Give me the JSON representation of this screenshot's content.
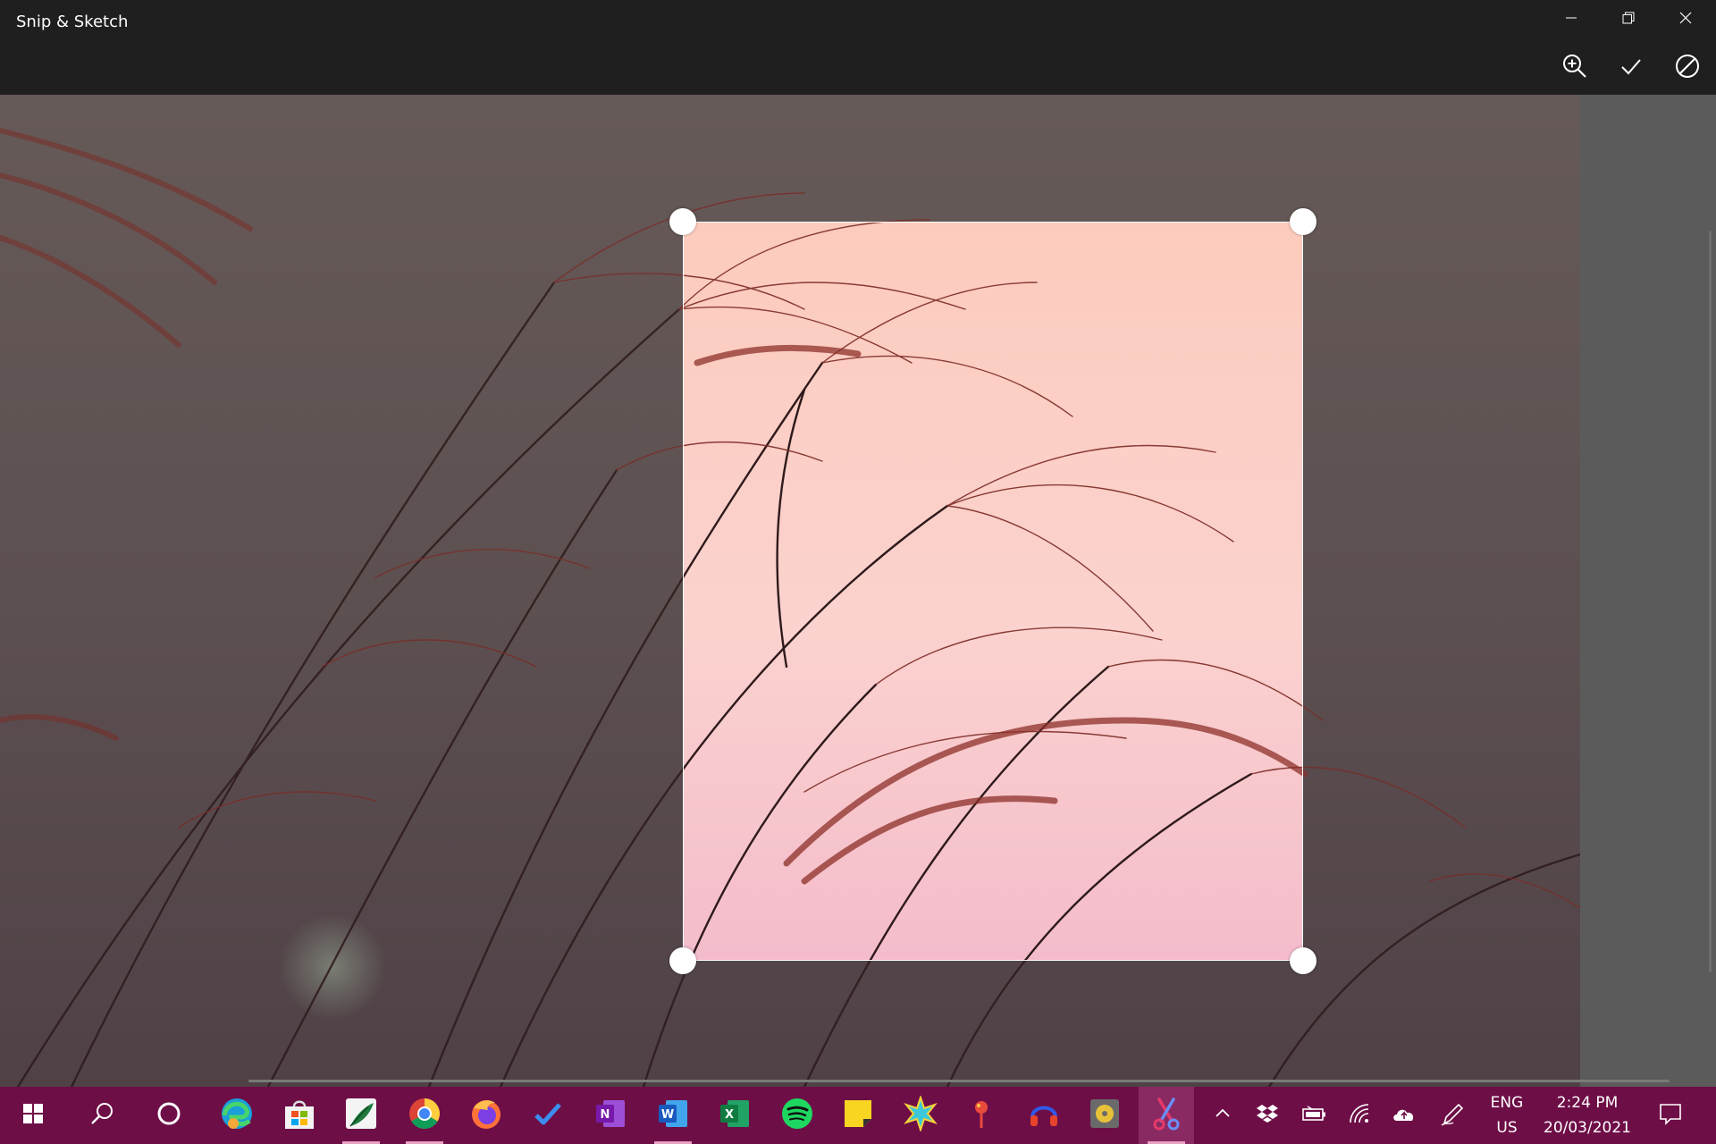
{
  "window": {
    "title": "Snip & Sketch",
    "controls": {
      "minimize": "minimize-icon",
      "restore": "restore-icon",
      "close": "close-icon"
    }
  },
  "toolbar": {
    "zoom": "zoom-in-icon",
    "apply": "checkmark-icon",
    "cancel": "cancel-icon"
  },
  "canvas": {
    "image": "photo of pampas grass against a pink dusk sky",
    "crop_state": "crop selection active"
  },
  "taskbar": {
    "apps": [
      {
        "name": "start",
        "icon": "windows-logo-icon"
      },
      {
        "name": "search",
        "icon": "search-icon"
      },
      {
        "name": "cortana",
        "icon": "cortana-icon"
      },
      {
        "name": "edge",
        "icon": "edge-icon"
      },
      {
        "name": "store",
        "icon": "store-icon"
      },
      {
        "name": "photo-app",
        "icon": "leaf-app-icon"
      },
      {
        "name": "chrome",
        "icon": "chrome-icon"
      },
      {
        "name": "firefox",
        "icon": "firefox-icon"
      },
      {
        "name": "todo",
        "icon": "todo-check-icon"
      },
      {
        "name": "onenote",
        "icon": "onenote-icon"
      },
      {
        "name": "word",
        "icon": "word-icon"
      },
      {
        "name": "excel",
        "icon": "excel-icon"
      },
      {
        "name": "spotify",
        "icon": "spotify-icon"
      },
      {
        "name": "sticky-notes",
        "icon": "sticky-notes-icon"
      },
      {
        "name": "sparkle-app",
        "icon": "starburst-icon"
      },
      {
        "name": "pin-app",
        "icon": "pin-icon"
      },
      {
        "name": "headphones-app",
        "icon": "headphones-icon"
      },
      {
        "name": "cd-app",
        "icon": "cd-icon"
      },
      {
        "name": "snip-and-sketch",
        "icon": "scissors-icon"
      }
    ],
    "tray": {
      "icons": [
        "chevron-up-icon",
        "dropbox-icon",
        "battery-icon",
        "wifi-icon",
        "onedrive-icon",
        "pen-icon"
      ],
      "language": {
        "line1": "ENG",
        "line2": "US"
      },
      "clock": {
        "time": "2:24 PM",
        "date": "20/03/2021"
      },
      "notifications": "notification-icon"
    }
  }
}
